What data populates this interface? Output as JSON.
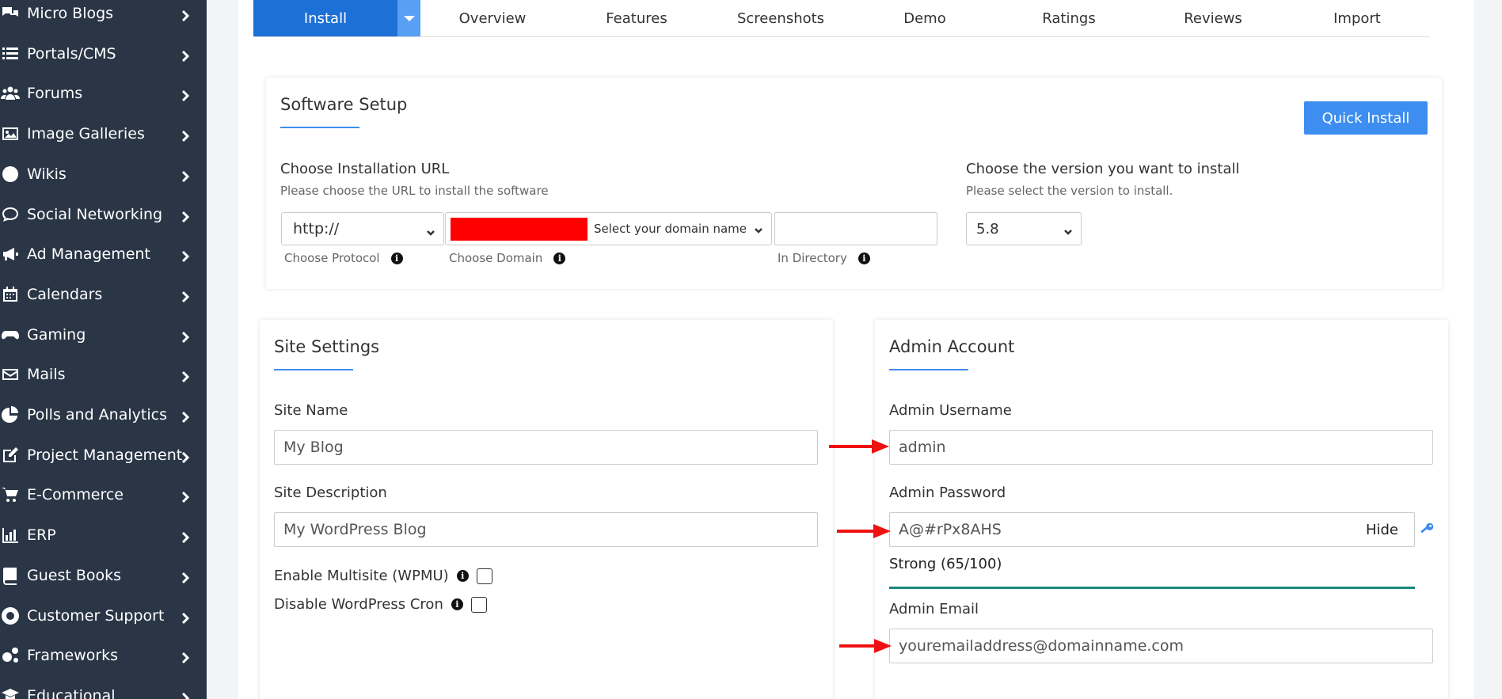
{
  "sidebar": {
    "items": [
      {
        "label": "Micro Blogs",
        "icon": "comments-icon"
      },
      {
        "label": "Portals/CMS",
        "icon": "list-icon"
      },
      {
        "label": "Forums",
        "icon": "users-icon"
      },
      {
        "label": "Image Galleries",
        "icon": "image-icon"
      },
      {
        "label": "Wikis",
        "icon": "globe-icon"
      },
      {
        "label": "Social Networking",
        "icon": "chat-icon"
      },
      {
        "label": "Ad Management",
        "icon": "megaphone-icon"
      },
      {
        "label": "Calendars",
        "icon": "calendar-icon"
      },
      {
        "label": "Gaming",
        "icon": "gamepad-icon"
      },
      {
        "label": "Mails",
        "icon": "envelope-icon"
      },
      {
        "label": "Polls and Analytics",
        "icon": "pie-chart-icon"
      },
      {
        "label": "Project Management",
        "icon": "edit-icon"
      },
      {
        "label": "E-Commerce",
        "icon": "cart-icon"
      },
      {
        "label": "ERP",
        "icon": "bar-chart-icon"
      },
      {
        "label": "Guest Books",
        "icon": "book-icon"
      },
      {
        "label": "Customer Support",
        "icon": "lifebuoy-icon"
      },
      {
        "label": "Frameworks",
        "icon": "cogs-icon"
      },
      {
        "label": "Educational",
        "icon": "graduation-cap-icon"
      }
    ]
  },
  "tabs": {
    "install": "Install",
    "overview": "Overview",
    "features": "Features",
    "screenshots": "Screenshots",
    "demo": "Demo",
    "ratings": "Ratings",
    "reviews": "Reviews",
    "import": "Import"
  },
  "software_setup": {
    "title": "Software Setup",
    "quick_install": "Quick Install",
    "url_heading": "Choose Installation URL",
    "url_sub": "Please choose the URL to install the software",
    "protocol_value": "http://",
    "domain_placeholder": "Select your domain name",
    "directory_value": "",
    "protocol_label": "Choose Protocol",
    "domain_label": "Choose Domain",
    "directory_label": "In Directory",
    "version_heading": "Choose the version you want to install",
    "version_sub": "Please select the version to install.",
    "version_value": "5.8"
  },
  "site_settings": {
    "title": "Site Settings",
    "site_name_label": "Site Name",
    "site_name_value": "My Blog",
    "site_desc_label": "Site Description",
    "site_desc_value": "My WordPress Blog",
    "multisite_label": "Enable Multisite (WPMU)",
    "cron_label": "Disable WordPress Cron"
  },
  "admin_account": {
    "title": "Admin Account",
    "username_label": "Admin Username",
    "username_value": "admin",
    "password_label": "Admin Password",
    "password_value": "A@#rPx8AHS",
    "hide_label": "Hide",
    "strength_label": "Strong (65/100)",
    "strength_fraction": 0.65,
    "email_label": "Admin Email",
    "email_value": "youremailaddress@domainname.com"
  },
  "colors": {
    "sidebar_bg": "#2a3646",
    "primary": "#3d8ef0",
    "tab_active": "#1d70d6",
    "strength_bar": "#1a8a78",
    "annotation_arrow": "#ee1111",
    "redaction": "#ff0000"
  }
}
